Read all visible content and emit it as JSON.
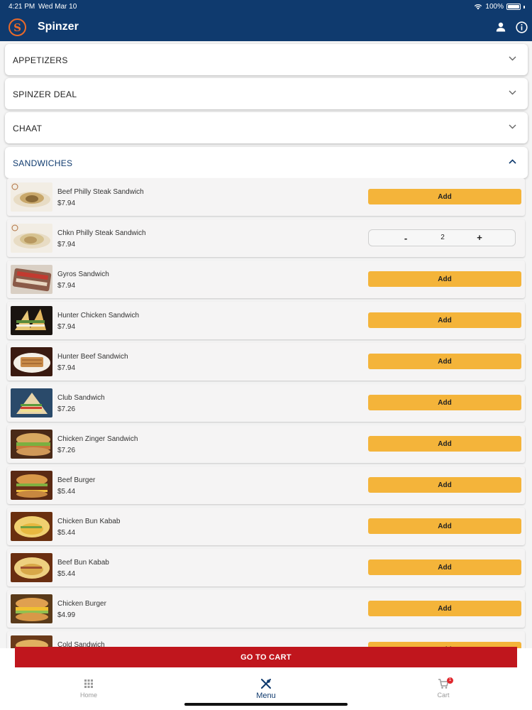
{
  "status_bar": {
    "time": "4:21 PM",
    "date": "Wed Mar 10",
    "battery": "100%"
  },
  "header": {
    "logo_letter": "S",
    "title": "Spinzer",
    "icons": [
      "person-icon",
      "info-icon"
    ]
  },
  "categories": [
    {
      "label": "APPETIZERS",
      "expanded": false
    },
    {
      "label": "SPINZER DEAL",
      "expanded": false
    },
    {
      "label": "CHAAT",
      "expanded": false
    },
    {
      "label": "SANDWICHES",
      "expanded": true
    }
  ],
  "items": [
    {
      "name": "Beef Philly Steak Sandwich",
      "price": "$7.94",
      "action": "Add"
    },
    {
      "name": "Chkn Philly Steak Sandwich",
      "price": "$7.94",
      "quantity": "2",
      "minus": "-",
      "plus": "+"
    },
    {
      "name": "Gyros Sandwich",
      "price": "$7.94",
      "action": "Add"
    },
    {
      "name": "Hunter Chicken Sandwich",
      "price": "$7.94",
      "action": "Add"
    },
    {
      "name": "Hunter Beef Sandwich",
      "price": "$7.94",
      "action": "Add"
    },
    {
      "name": "Club Sandwich",
      "price": "$7.26",
      "action": "Add"
    },
    {
      "name": "Chicken Zinger Sandwich",
      "price": "$7.26",
      "action": "Add"
    },
    {
      "name": "Beef Burger",
      "price": "$5.44",
      "action": "Add"
    },
    {
      "name": "Chicken Bun Kabab",
      "price": "$5.44",
      "action": "Add"
    },
    {
      "name": "Beef Bun Kabab",
      "price": "$5.44",
      "action": "Add"
    },
    {
      "name": "Chicken Burger",
      "price": "$4.99",
      "action": "Add"
    },
    {
      "name": "Cold Sandwich",
      "price": "",
      "action": "Add"
    }
  ],
  "go_to_cart": "GO TO CART",
  "tabs": [
    {
      "label": "Home",
      "icon": "grid-icon"
    },
    {
      "label": "Menu",
      "icon": "utensils-icon"
    },
    {
      "label": "Cart",
      "icon": "cart-icon",
      "badge": "1"
    }
  ],
  "colors": {
    "header": "#0f3a6e",
    "add_button": "#f4b43a",
    "cart_button": "#c0161d",
    "logo": "#e96a2a"
  }
}
